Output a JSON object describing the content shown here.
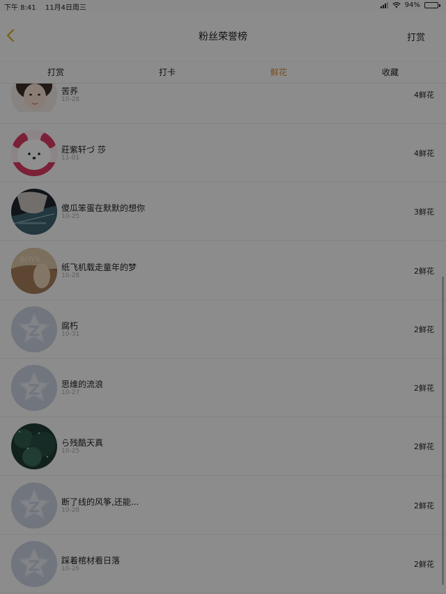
{
  "status_bar": {
    "time": "下午 8:41",
    "date": "11月4日周三",
    "battery": "94%",
    "battery_level": 0.94
  },
  "nav": {
    "title": "粉丝荣誉榜",
    "action": "打赏"
  },
  "tabs": [
    {
      "label": "打赏",
      "active": false
    },
    {
      "label": "打卡",
      "active": false
    },
    {
      "label": "鲜花",
      "active": true
    },
    {
      "label": "收藏",
      "active": false
    }
  ],
  "colors": {
    "active_tab": "#d9882b"
  },
  "rows": [
    {
      "name": "苦荞",
      "date": "10-28",
      "count": "4鲜花",
      "avatar": "photo-girl"
    },
    {
      "name": "莊紫轩づ 莎",
      "date": "11-01",
      "count": "4鲜花",
      "avatar": "pink-bear"
    },
    {
      "name": "傻瓜笨蛋在默默的想你",
      "date": "10-25",
      "count": "3鲜花",
      "avatar": "photo-dark"
    },
    {
      "name": "纸飞机载走童年的梦",
      "date": "10-28",
      "count": "2鲜花",
      "avatar": "photo-warm"
    },
    {
      "name": "腐朽",
      "date": "10-31",
      "count": "2鲜花",
      "avatar": "default-star"
    },
    {
      "name": "思维的流浪",
      "date": "10-27",
      "count": "2鲜花",
      "avatar": "default-star"
    },
    {
      "name": "ら残酷天真",
      "date": "10-25",
      "count": "2鲜花",
      "avatar": "photo-green"
    },
    {
      "name": "断了线的风筝,还能...",
      "date": "10-28",
      "count": "2鲜花",
      "avatar": "default-star"
    },
    {
      "name": "踩着棺材看日落",
      "date": "10-26",
      "count": "2鲜花",
      "avatar": "default-star"
    }
  ]
}
